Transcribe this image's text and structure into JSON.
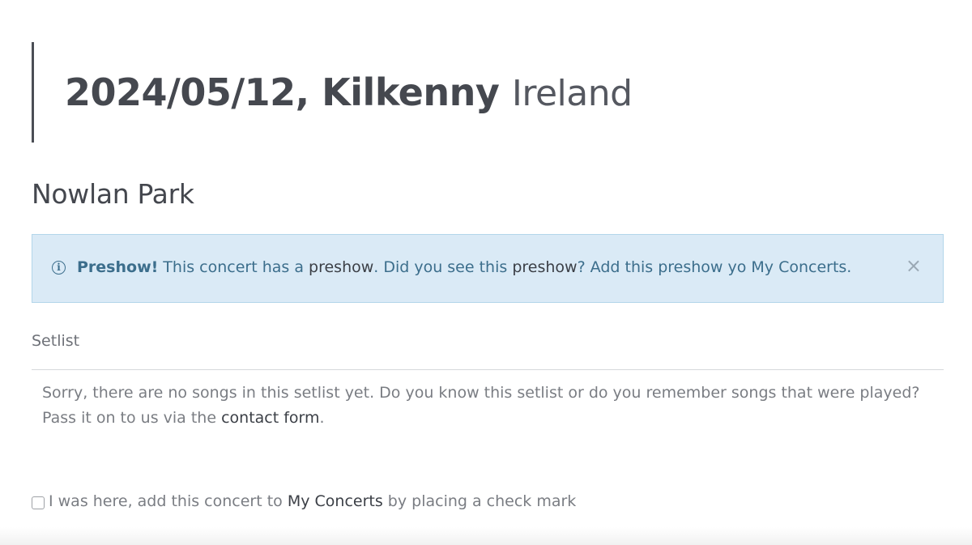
{
  "header": {
    "date_city": "2024/05/12, Kilkenny",
    "country": "Ireland"
  },
  "venue": "Nowlan Park",
  "alert": {
    "icon": "info-icon",
    "title": "Preshow!",
    "text1": "This concert has a",
    "preshow_link": "preshow",
    "text2": ".",
    "question": "Did you see this",
    "preshow_link2": "preshow",
    "text3": "?",
    "add_link": "Add this preshow yo My Concerts.",
    "close_label": "×"
  },
  "setlist": {
    "label": "Setlist",
    "message": "Sorry, there are no songs in this setlist yet. Do you know this setlist or do you remember songs that were played? Pass it on to us via the",
    "contact_link": "contact form",
    "message_end": "."
  },
  "checkbox": {
    "checked": false,
    "text1": "I was here, add this concert to",
    "my_concerts_link": "My Concerts",
    "text2": "by placing a check mark"
  },
  "colors": {
    "alert_bg": "#daeaf6",
    "alert_text": "#3c6e8c",
    "heading": "#45484f"
  }
}
